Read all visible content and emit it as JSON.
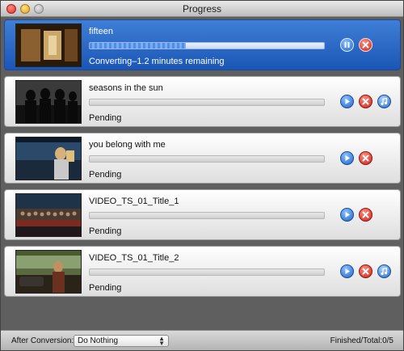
{
  "window": {
    "title": "Progress"
  },
  "items": [
    {
      "name": "fifteen",
      "status": "Converting–1.2 minutes remaining",
      "progress_percent": 41,
      "state": "converting",
      "controls": [
        "pause",
        "cancel"
      ]
    },
    {
      "name": "seasons in the sun",
      "status": "Pending",
      "progress_percent": 0,
      "state": "pending",
      "controls": [
        "start",
        "cancel",
        "itunes"
      ]
    },
    {
      "name": "you belong with me",
      "status": "Pending",
      "progress_percent": 0,
      "state": "pending",
      "controls": [
        "start",
        "cancel"
      ]
    },
    {
      "name": "VIDEO_TS_01_Title_1",
      "status": "Pending",
      "progress_percent": 0,
      "state": "pending",
      "controls": [
        "start",
        "cancel"
      ]
    },
    {
      "name": "VIDEO_TS_01_Title_2",
      "status": "Pending",
      "progress_percent": 0,
      "state": "pending",
      "controls": [
        "start",
        "cancel",
        "itunes"
      ]
    }
  ],
  "footer": {
    "after_conversion_label": "After Conversion:",
    "after_conversion_value": "Do Nothing",
    "finished_total": "Finished/Total:0/5"
  },
  "colors": {
    "active_row": "#2a66c4",
    "start_button": "#1f66c9",
    "cancel_button": "#cf2418"
  }
}
